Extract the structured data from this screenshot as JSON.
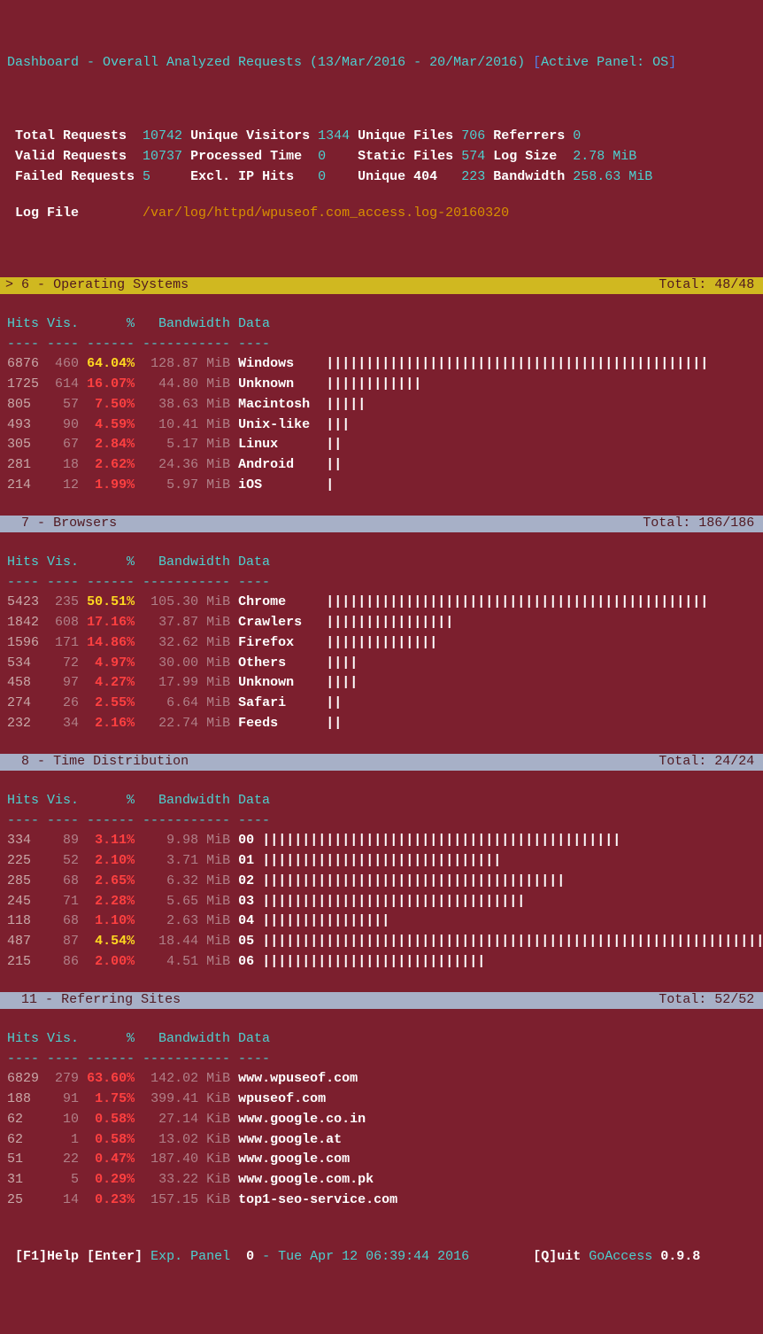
{
  "title": {
    "left": "Dashboard - Overall Analyzed Requests (13/Mar/2016 - 20/Mar/2016)",
    "bracket_open": "[",
    "active": "Active Panel: OS",
    "bracket_close": "]"
  },
  "summary": [
    {
      "l1": "Total Requests  ",
      "v1": "10742",
      "l2": "Unique Visitors",
      "v2": "1344",
      "l3": "Unique Files",
      "v3": "706",
      "l4": "Referrers",
      "v4": "0"
    },
    {
      "l1": "Valid Requests  ",
      "v1": "10737",
      "l2": "Processed Time ",
      "v2": "0   ",
      "l3": "Static Files",
      "v3": "574",
      "l4": "Log Size ",
      "v4": "2.78 MiB"
    },
    {
      "l1": "Failed Requests ",
      "v1": "5    ",
      "l2": "Excl. IP Hits  ",
      "v2": "0   ",
      "l3": "Unique 404  ",
      "v3": "223",
      "l4": "Bandwidth",
      "v4": "258.63 MiB"
    }
  ],
  "log": {
    "label": "Log File        ",
    "value": "/var/log/httpd/wpuseof.com_access.log-20160320"
  },
  "panels": [
    {
      "active": true,
      "prefix": "> ",
      "num": "6",
      "title": "Operating Systems",
      "total": "Total: 48/48",
      "cols": "Hits Vis.      %   Bandwidth Data",
      "sep": "---- ---- ------ ----------- ----",
      "rows": [
        {
          "hits": "6876",
          "vis": "460",
          "pct": "64.04%",
          "bw": "128.87",
          "unit": "MiB",
          "data": "Windows   ",
          "bar": "||||||||||||||||||||||||||||||||||||||||||||||||",
          "hl": true
        },
        {
          "hits": "1725",
          "vis": "614",
          "pct": "16.07%",
          "bw": " 44.80",
          "unit": "MiB",
          "data": "Unknown   ",
          "bar": "||||||||||||"
        },
        {
          "hits": "805 ",
          "vis": " 57",
          "pct": " 7.50%",
          "bw": " 38.63",
          "unit": "MiB",
          "data": "Macintosh ",
          "bar": "|||||"
        },
        {
          "hits": "493 ",
          "vis": " 90",
          "pct": " 4.59%",
          "bw": " 10.41",
          "unit": "MiB",
          "data": "Unix-like ",
          "bar": "|||"
        },
        {
          "hits": "305 ",
          "vis": " 67",
          "pct": " 2.84%",
          "bw": "  5.17",
          "unit": "MiB",
          "data": "Linux     ",
          "bar": "||"
        },
        {
          "hits": "281 ",
          "vis": " 18",
          "pct": " 2.62%",
          "bw": " 24.36",
          "unit": "MiB",
          "data": "Android   ",
          "bar": "||"
        },
        {
          "hits": "214 ",
          "vis": " 12",
          "pct": " 1.99%",
          "bw": "  5.97",
          "unit": "MiB",
          "data": "iOS       ",
          "bar": "|"
        }
      ]
    },
    {
      "num": "7",
      "title": "Browsers",
      "total": "Total: 186/186",
      "cols": "Hits Vis.      %   Bandwidth Data",
      "sep": "---- ---- ------ ----------- ----",
      "rows": [
        {
          "hits": "5423",
          "vis": "235",
          "pct": "50.51%",
          "bw": "105.30",
          "unit": "MiB",
          "data": "Chrome    ",
          "bar": "||||||||||||||||||||||||||||||||||||||||||||||||",
          "hl": true
        },
        {
          "hits": "1842",
          "vis": "608",
          "pct": "17.16%",
          "bw": " 37.87",
          "unit": "MiB",
          "data": "Crawlers  ",
          "bar": "||||||||||||||||"
        },
        {
          "hits": "1596",
          "vis": "171",
          "pct": "14.86%",
          "bw": " 32.62",
          "unit": "MiB",
          "data": "Firefox   ",
          "bar": "||||||||||||||"
        },
        {
          "hits": "534 ",
          "vis": " 72",
          "pct": " 4.97%",
          "bw": " 30.00",
          "unit": "MiB",
          "data": "Others    ",
          "bar": "||||"
        },
        {
          "hits": "458 ",
          "vis": " 97",
          "pct": " 4.27%",
          "bw": " 17.99",
          "unit": "MiB",
          "data": "Unknown   ",
          "bar": "||||"
        },
        {
          "hits": "274 ",
          "vis": " 26",
          "pct": " 2.55%",
          "bw": "  6.64",
          "unit": "MiB",
          "data": "Safari    ",
          "bar": "||"
        },
        {
          "hits": "232 ",
          "vis": " 34",
          "pct": " 2.16%",
          "bw": " 22.74",
          "unit": "MiB",
          "data": "Feeds     ",
          "bar": "||"
        }
      ]
    },
    {
      "num": "8",
      "title": "Time Distribution",
      "total": "Total: 24/24",
      "cols": "Hits Vis.      %   Bandwidth Data",
      "sep": "---- ---- ------ ----------- ----",
      "rows": [
        {
          "hits": "334 ",
          "vis": " 89",
          "pct": " 3.11%",
          "bw": "  9.98",
          "unit": "MiB",
          "data": "00",
          "bar": "|||||||||||||||||||||||||||||||||||||||||||||"
        },
        {
          "hits": "225 ",
          "vis": " 52",
          "pct": " 2.10%",
          "bw": "  3.71",
          "unit": "MiB",
          "data": "01",
          "bar": "||||||||||||||||||||||||||||||"
        },
        {
          "hits": "285 ",
          "vis": " 68",
          "pct": " 2.65%",
          "bw": "  6.32",
          "unit": "MiB",
          "data": "02",
          "bar": "||||||||||||||||||||||||||||||||||||||"
        },
        {
          "hits": "245 ",
          "vis": " 71",
          "pct": " 2.28%",
          "bw": "  5.65",
          "unit": "MiB",
          "data": "03",
          "bar": "|||||||||||||||||||||||||||||||||"
        },
        {
          "hits": "118 ",
          "vis": " 68",
          "pct": " 1.10%",
          "bw": "  2.63",
          "unit": "MiB",
          "data": "04",
          "bar": "||||||||||||||||"
        },
        {
          "hits": "487 ",
          "vis": " 87",
          "pct": " 4.54%",
          "bw": " 18.44",
          "unit": "MiB",
          "data": "05",
          "bar": "||||||||||||||||||||||||||||||||||||||||||||||||||||||||||||||||",
          "hl": true
        },
        {
          "hits": "215 ",
          "vis": " 86",
          "pct": " 2.00%",
          "bw": "  4.51",
          "unit": "MiB",
          "data": "06",
          "bar": "||||||||||||||||||||||||||||"
        }
      ]
    },
    {
      "num": "11",
      "title": "Referring Sites",
      "total": "Total: 52/52",
      "cols": "Hits Vis.      %   Bandwidth Data",
      "sep": "---- ---- ------ ----------- ----",
      "rows": [
        {
          "hits": "6829",
          "vis": "279",
          "pct": "63.60%",
          "bw": "142.02",
          "unit": "MiB",
          "data": "www.wpuseof.com"
        },
        {
          "hits": "188 ",
          "vis": " 91",
          "pct": " 1.75%",
          "bw": "399.41",
          "unit": "KiB",
          "data": "wpuseof.com"
        },
        {
          "hits": "62  ",
          "vis": " 10",
          "pct": " 0.58%",
          "bw": " 27.14",
          "unit": "KiB",
          "data": "www.google.co.in"
        },
        {
          "hits": "62  ",
          "vis": "  1",
          "pct": " 0.58%",
          "bw": " 13.02",
          "unit": "KiB",
          "data": "www.google.at"
        },
        {
          "hits": "51  ",
          "vis": " 22",
          "pct": " 0.47%",
          "bw": "187.40",
          "unit": "KiB",
          "data": "www.google.com"
        },
        {
          "hits": "31  ",
          "vis": "  5",
          "pct": " 0.29%",
          "bw": " 33.22",
          "unit": "KiB",
          "data": "www.google.com.pk"
        },
        {
          "hits": "25  ",
          "vis": " 14",
          "pct": " 0.23%",
          "bw": "157.15",
          "unit": "KiB",
          "data": "top1-seo-service.com"
        }
      ]
    }
  ],
  "footer": {
    "help": "[F1]Help",
    "enter": "[Enter]",
    "exp": "Exp. Panel",
    "zero": "0",
    "date": "- Tue Apr 12 06:39:44 2016",
    "quit": "[Q]uit",
    "app": "GoAccess",
    "ver": "0.9.8"
  }
}
